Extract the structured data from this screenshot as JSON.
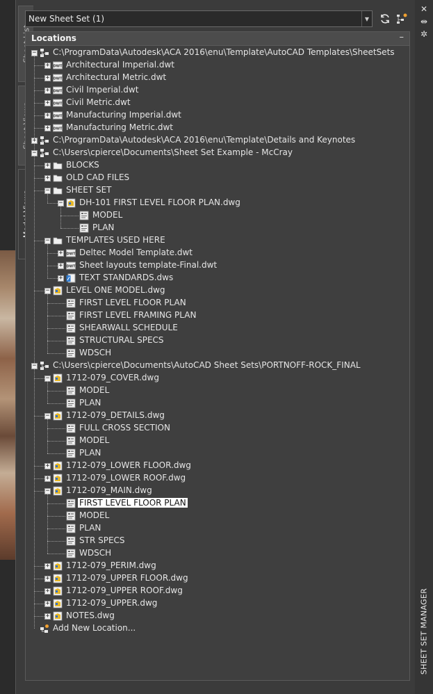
{
  "sheet_set_selector": {
    "value": "New Sheet Set (1)"
  },
  "toolbar": {
    "refresh_icon": "refresh-icon",
    "options_icon": "sheet-options-icon"
  },
  "vertical_tabs": [
    "Sheet List",
    "Sheet Views",
    "Model Views"
  ],
  "active_tab": "Model Views",
  "panel": {
    "title": "Locations",
    "collapse_label": "–"
  },
  "palette": {
    "title": "SHEET SET MANAGER"
  },
  "window_controls": {
    "close": "✕",
    "autohide": "⇹",
    "properties": "✲"
  },
  "tree": [
    {
      "level": 0,
      "toggle": "-",
      "icon": "location",
      "label": "C:\\ProgramData\\Autodesk\\ACA 2016\\enu\\Template\\AutoCAD Templates\\SheetSets"
    },
    {
      "level": 1,
      "toggle": "+",
      "icon": "dwt",
      "label": "Architectural Imperial.dwt"
    },
    {
      "level": 1,
      "toggle": "+",
      "icon": "dwt",
      "label": "Architectural Metric.dwt"
    },
    {
      "level": 1,
      "toggle": "+",
      "icon": "dwt",
      "label": "Civil Imperial.dwt"
    },
    {
      "level": 1,
      "toggle": "+",
      "icon": "dwt",
      "label": "Civil Metric.dwt"
    },
    {
      "level": 1,
      "toggle": "+",
      "icon": "dwt",
      "label": "Manufacturing Imperial.dwt"
    },
    {
      "level": 1,
      "toggle": "+",
      "icon": "dwt",
      "label": "Manufacturing Metric.dwt"
    },
    {
      "level": 0,
      "toggle": "+",
      "icon": "location",
      "label": "C:\\ProgramData\\Autodesk\\ACA 2016\\enu\\Template\\Details and Keynotes"
    },
    {
      "level": 0,
      "toggle": "-",
      "icon": "location",
      "label": "C:\\Users\\cpierce\\Documents\\Sheet Set Example - McCray"
    },
    {
      "level": 1,
      "toggle": "+",
      "icon": "folder",
      "label": "BLOCKS"
    },
    {
      "level": 1,
      "toggle": "+",
      "icon": "folder",
      "label": "OLD CAD FILES"
    },
    {
      "level": 1,
      "toggle": "-",
      "icon": "folder",
      "label": "SHEET SET"
    },
    {
      "level": 2,
      "toggle": "-",
      "icon": "dwg",
      "label": "DH-101 FIRST LEVEL FLOOR PLAN.dwg"
    },
    {
      "level": 3,
      "toggle": "",
      "icon": "view",
      "label": "MODEL"
    },
    {
      "level": 3,
      "toggle": "",
      "icon": "view",
      "label": "PLAN"
    },
    {
      "level": 1,
      "toggle": "-",
      "icon": "folder",
      "label": "TEMPLATES USED HERE"
    },
    {
      "level": 2,
      "toggle": "+",
      "icon": "dwt",
      "label": "Deltec Model Template.dwt"
    },
    {
      "level": 2,
      "toggle": "+",
      "icon": "dwt",
      "label": "Sheet layouts template-Final.dwt"
    },
    {
      "level": 2,
      "toggle": "+",
      "icon": "dws",
      "label": "TEXT STANDARDS.dws"
    },
    {
      "level": 1,
      "toggle": "-",
      "icon": "dwg",
      "label": "LEVEL ONE MODEL.dwg"
    },
    {
      "level": 2,
      "toggle": "",
      "icon": "view",
      "label": "FIRST LEVEL FLOOR PLAN"
    },
    {
      "level": 2,
      "toggle": "",
      "icon": "view",
      "label": "FIRST LEVEL FRAMING PLAN"
    },
    {
      "level": 2,
      "toggle": "",
      "icon": "view",
      "label": "SHEARWALL SCHEDULE"
    },
    {
      "level": 2,
      "toggle": "",
      "icon": "view",
      "label": "STRUCTURAL SPECS"
    },
    {
      "level": 2,
      "toggle": "",
      "icon": "view",
      "label": "WDSCH"
    },
    {
      "level": 0,
      "toggle": "-",
      "icon": "location",
      "label": "C:\\Users\\cpierce\\Documents\\AutoCAD Sheet Sets\\PORTNOFF-ROCK_FINAL"
    },
    {
      "level": 1,
      "toggle": "-",
      "icon": "dwg",
      "label": "1712-079_COVER.dwg"
    },
    {
      "level": 2,
      "toggle": "",
      "icon": "view",
      "label": "MODEL"
    },
    {
      "level": 2,
      "toggle": "",
      "icon": "view",
      "label": "PLAN"
    },
    {
      "level": 1,
      "toggle": "-",
      "icon": "dwg",
      "label": "1712-079_DETAILS.dwg"
    },
    {
      "level": 2,
      "toggle": "",
      "icon": "view",
      "label": "FULL CROSS SECTION"
    },
    {
      "level": 2,
      "toggle": "",
      "icon": "view",
      "label": "MODEL"
    },
    {
      "level": 2,
      "toggle": "",
      "icon": "view",
      "label": "PLAN"
    },
    {
      "level": 1,
      "toggle": "+",
      "icon": "dwg",
      "label": "1712-079_LOWER FLOOR.dwg"
    },
    {
      "level": 1,
      "toggle": "+",
      "icon": "dwg",
      "label": "1712-079_LOWER ROOF.dwg"
    },
    {
      "level": 1,
      "toggle": "-",
      "icon": "dwg",
      "label": "1712-079_MAIN.dwg"
    },
    {
      "level": 2,
      "toggle": "",
      "icon": "view",
      "label": "FIRST LEVEL FLOOR PLAN",
      "selected": true
    },
    {
      "level": 2,
      "toggle": "",
      "icon": "view",
      "label": "MODEL"
    },
    {
      "level": 2,
      "toggle": "",
      "icon": "view",
      "label": "PLAN"
    },
    {
      "level": 2,
      "toggle": "",
      "icon": "view",
      "label": "STR SPECS"
    },
    {
      "level": 2,
      "toggle": "",
      "icon": "view",
      "label": "WDSCH"
    },
    {
      "level": 1,
      "toggle": "+",
      "icon": "dwg",
      "label": "1712-079_PERIM.dwg"
    },
    {
      "level": 1,
      "toggle": "+",
      "icon": "dwg",
      "label": "1712-079_UPPER FLOOR.dwg"
    },
    {
      "level": 1,
      "toggle": "+",
      "icon": "dwg",
      "label": "1712-079_UPPER ROOF.dwg"
    },
    {
      "level": 1,
      "toggle": "+",
      "icon": "dwg",
      "label": "1712-079_UPPER.dwg"
    },
    {
      "level": 1,
      "toggle": "+",
      "icon": "dwg",
      "label": "NOTES.dwg"
    },
    {
      "level": 0,
      "toggle": "",
      "icon": "add-location",
      "label": "Add New Location..."
    }
  ]
}
